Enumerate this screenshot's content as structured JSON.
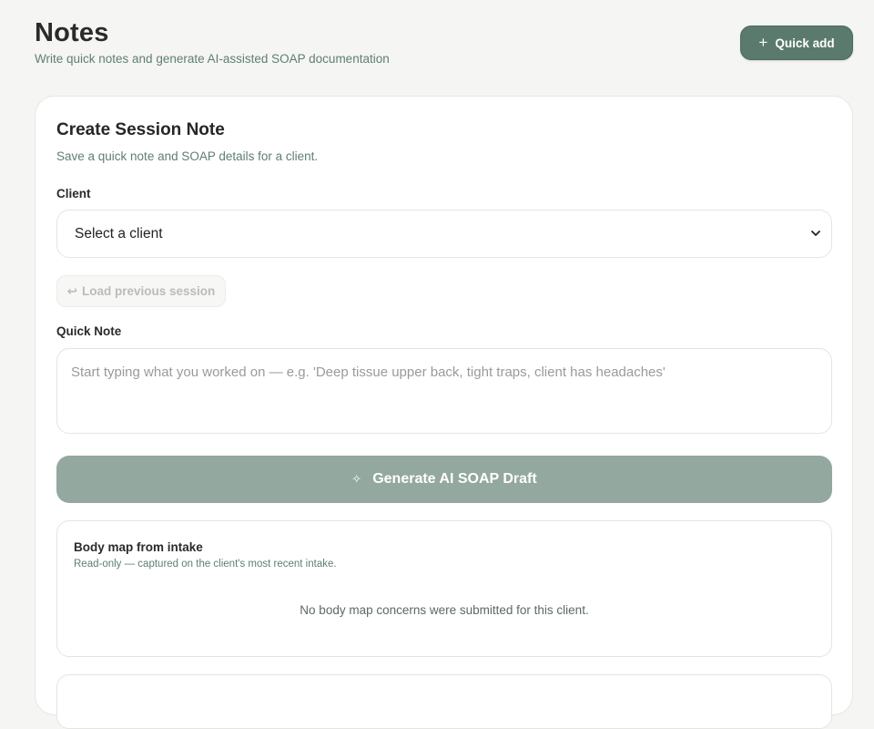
{
  "header": {
    "title": "Notes",
    "subtitle": "Write quick notes and generate AI-assisted SOAP documentation",
    "quick_add": {
      "icon": "plus-icon",
      "label": "Quick add"
    }
  },
  "card": {
    "title": "Create Session Note",
    "subtitle": "Save a quick note and SOAP details for a client.",
    "client_label": "Client",
    "client_select": {
      "value": "Select a client",
      "icon": "chevron-down-icon"
    },
    "load_previous": {
      "icon": "return-arrow-icon",
      "glyph": "↩",
      "label": "Load previous session"
    },
    "quick_note_label": "Quick Note",
    "quick_note_placeholder": "Start typing what you worked on — e.g. 'Deep tissue upper back, tight traps, client has headaches'",
    "generate": {
      "icon": "sparkle-icon",
      "glyph": "✧",
      "label": "Generate AI SOAP Draft"
    },
    "body_map": {
      "title": "Body map from intake",
      "subtitle": "Read-only — captured on the client's most recent intake.",
      "empty_text": "No body map concerns were submitted for this client."
    }
  },
  "colors": {
    "accent": "#5a7a6d",
    "accent_disabled": "#93a89f",
    "muted_text": "#5f7f71",
    "background": "#f5f5f3"
  }
}
